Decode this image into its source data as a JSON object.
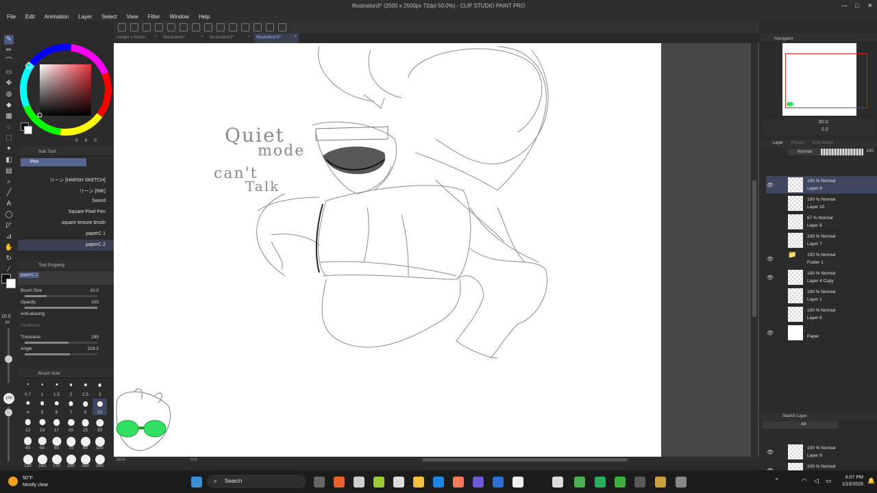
{
  "window": {
    "title": "Illustration3* (2500 x 2500px 72dpi 50.0%) - CLIP STUDIO PAINT PRO"
  },
  "menu": [
    "File",
    "Edit",
    "Animation",
    "Layer",
    "Select",
    "View",
    "Filter",
    "Window",
    "Help"
  ],
  "tabs": [
    {
      "label": "rodger x fortun"
    },
    {
      "label": "Illustration*"
    },
    {
      "label": "Illustration2*"
    },
    {
      "label": "Illustration3*",
      "active": true
    }
  ],
  "colors": {
    "accent": "#4b5a85",
    "selected_row": "#3f4660",
    "tab_active_text": "#9fb4ff",
    "main_color": "#111111",
    "sub_color": "#ffffff"
  },
  "color_wheel": {
    "values": [
      "0",
      "0",
      "0"
    ]
  },
  "subtool": {
    "header": "Sub Tool",
    "group": "Pen",
    "brushes": [
      {
        "label": "リーン [HARSH SKETCH]"
      },
      {
        "label": "リーン [INK]"
      },
      {
        "label": "Sword"
      },
      {
        "label": "Square Pixel Pen"
      },
      {
        "label": "square texture brush"
      },
      {
        "label": "paperC 1"
      },
      {
        "label": "paperC 2",
        "selected": true
      }
    ]
  },
  "tool_property": {
    "header": "Tool Property",
    "brush_name": "paperC 2",
    "brush_size": {
      "label": "Brush Size",
      "value": "10.0"
    },
    "opacity": {
      "label": "Opacity",
      "value": "100"
    },
    "anti_aliasing": {
      "label": "Anti-aliasing"
    },
    "hardness": {
      "label": "Hardness"
    },
    "thickness": {
      "label": "Thickness",
      "value": "195"
    },
    "angle": {
      "label": "Angle",
      "value": "224.2"
    }
  },
  "left_indicators": {
    "size": "10.0",
    "unit": "px",
    "opacity": "100"
  },
  "brush_size_panel": {
    "header": "Brush Size",
    "sizes": [
      "0.7",
      "1",
      "1.5",
      "2",
      "2.5",
      "3",
      "4",
      "5",
      "6",
      "7",
      "8",
      "10",
      "12",
      "15",
      "17",
      "20",
      "25",
      "30",
      "40",
      "50",
      "60",
      "70",
      "80",
      "100",
      "120",
      "150",
      "170",
      "200",
      "250",
      "300"
    ],
    "selected": "10"
  },
  "canvas_text": {
    "quiet": "Quiet",
    "mode": "mode",
    "cant": "can't",
    "talk": "Talk"
  },
  "statusbar": {
    "zoom": "50.0",
    "angle": "0.0"
  },
  "navigator": {
    "header": "Navigator",
    "zoom": "50.0",
    "rotation": "0.0"
  },
  "layer_panel": {
    "tabs": [
      "Layer",
      "History",
      "Auto Action"
    ],
    "blend_mode": "Normal",
    "opacity": "100",
    "layers": [
      {
        "mode": "100 % Normal",
        "name": "Layer 9",
        "visible": true,
        "selected": true
      },
      {
        "mode": "100 % Normal",
        "name": "Layer 10",
        "visible": false
      },
      {
        "mode": "67 % Normal",
        "name": "Layer 8",
        "visible": false
      },
      {
        "mode": "100 % Normal",
        "name": "Layer 7",
        "visible": false
      },
      {
        "mode": "100 % Normal",
        "name": "Folder 1",
        "visible": true,
        "folder": true
      },
      {
        "mode": "100 % Normal",
        "name": "Layer 4 Copy",
        "visible": true
      },
      {
        "mode": "100 % Normal",
        "name": "Layer 1",
        "visible": false
      },
      {
        "mode": "100 % Normal",
        "name": "Layer 6",
        "visible": false
      },
      {
        "mode": "",
        "name": "Paper",
        "visible": true,
        "paper": true
      }
    ]
  },
  "search_layer": {
    "header": "Search Layer",
    "filter": "All",
    "results": [
      {
        "mode": "100 % Normal",
        "name": "Layer 9"
      },
      {
        "mode": "100 % Normal",
        "name": ""
      }
    ]
  },
  "taskbar": {
    "weather_temp": "50°F",
    "weather_desc": "Mostly clear",
    "search": "Search",
    "time": "6:07 PM",
    "date": "1/10/2026"
  }
}
